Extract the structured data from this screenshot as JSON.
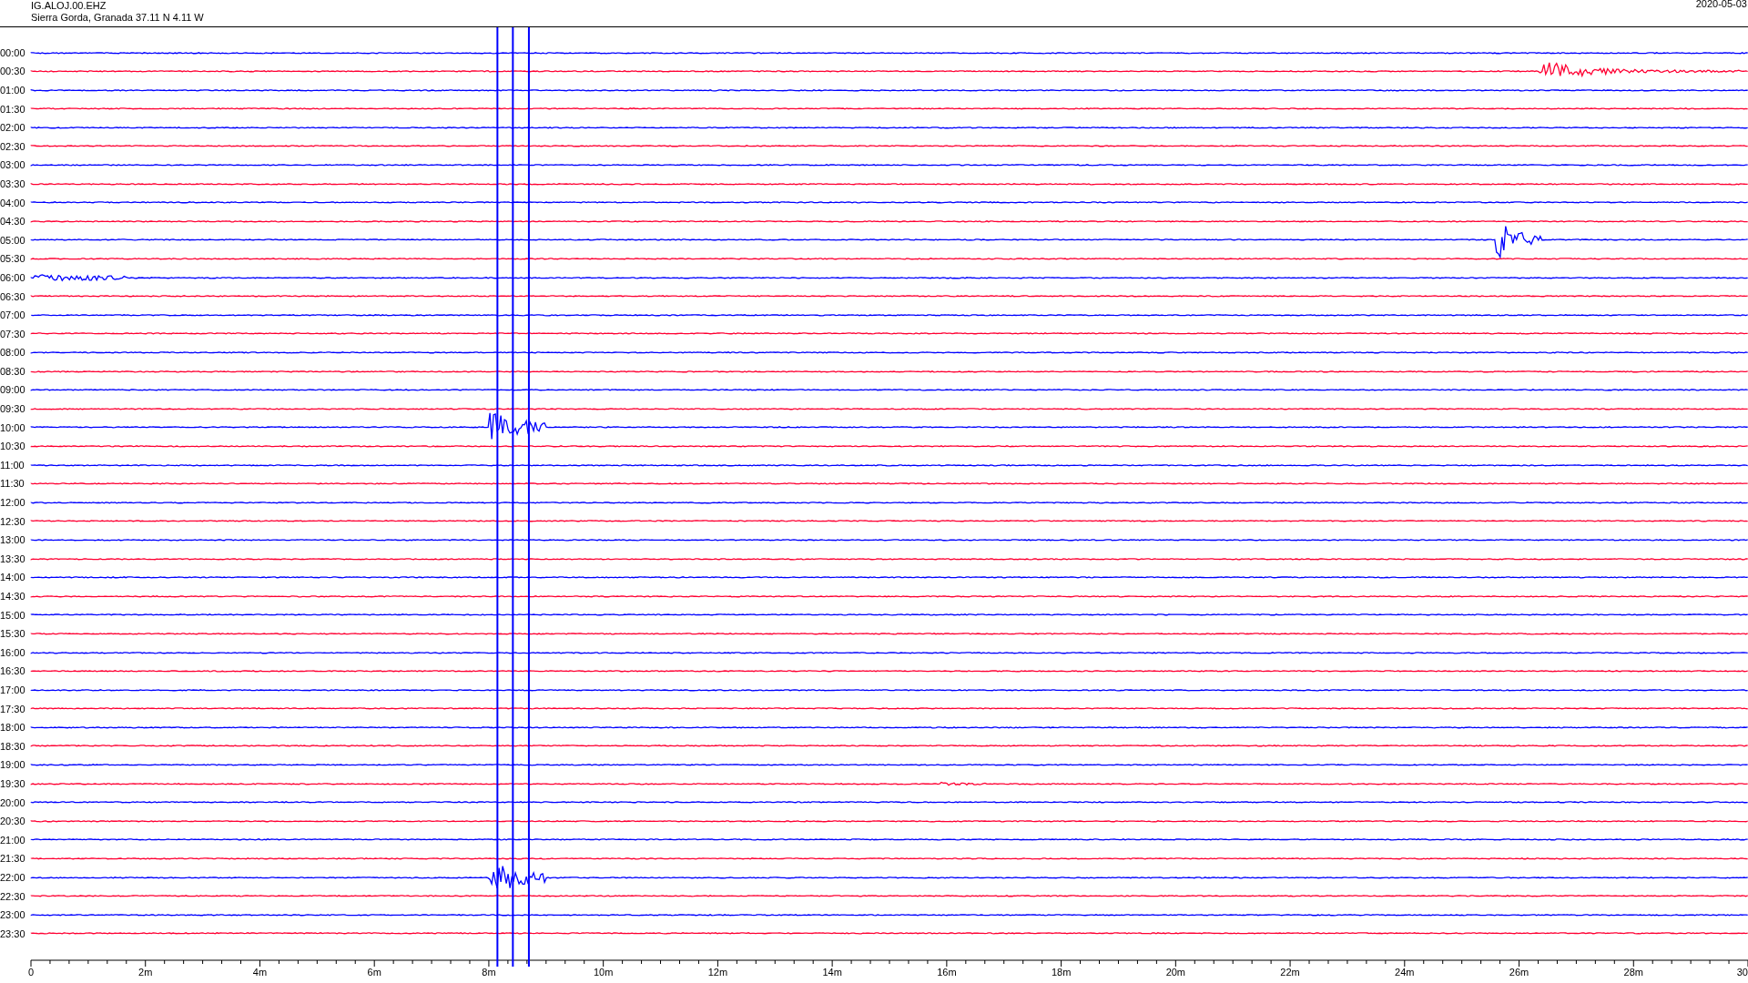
{
  "header": {
    "station": "IG.ALOJ.00.EHZ",
    "location": "Sierra Gorda, Granada  37.11 N 4.11 W",
    "date": "2020-05-03"
  },
  "rows": [
    {
      "time": "00:00",
      "color": "#0000ff"
    },
    {
      "time": "00:30",
      "color": "#ff0033"
    },
    {
      "time": "01:00",
      "color": "#0000ff"
    },
    {
      "time": "01:30",
      "color": "#ff0033"
    },
    {
      "time": "02:00",
      "color": "#0000ff"
    },
    {
      "time": "02:30",
      "color": "#ff0033"
    },
    {
      "time": "03:00",
      "color": "#0000ff"
    },
    {
      "time": "03:30",
      "color": "#ff0033"
    },
    {
      "time": "04:00",
      "color": "#0000ff"
    },
    {
      "time": "04:30",
      "color": "#ff0033"
    },
    {
      "time": "05:00",
      "color": "#0000ff"
    },
    {
      "time": "05:30",
      "color": "#ff0033"
    },
    {
      "time": "06:00",
      "color": "#0000ff"
    },
    {
      "time": "06:30",
      "color": "#ff0033"
    },
    {
      "time": "07:00",
      "color": "#0000ff"
    },
    {
      "time": "07:30",
      "color": "#ff0033"
    },
    {
      "time": "08:00",
      "color": "#0000ff"
    },
    {
      "time": "08:30",
      "color": "#ff0033"
    },
    {
      "time": "09:00",
      "color": "#0000ff"
    },
    {
      "time": "09:30",
      "color": "#ff0033"
    },
    {
      "time": "10:00",
      "color": "#0000ff"
    },
    {
      "time": "10:30",
      "color": "#ff0033"
    },
    {
      "time": "11:00",
      "color": "#0000ff"
    },
    {
      "time": "11:30",
      "color": "#ff0033"
    },
    {
      "time": "12:00",
      "color": "#0000ff"
    },
    {
      "time": "12:30",
      "color": "#ff0033"
    },
    {
      "time": "13:00",
      "color": "#0000ff"
    },
    {
      "time": "13:30",
      "color": "#ff0033"
    },
    {
      "time": "14:00",
      "color": "#0000ff"
    },
    {
      "time": "14:30",
      "color": "#ff0033"
    },
    {
      "time": "15:00",
      "color": "#0000ff"
    },
    {
      "time": "15:30",
      "color": "#ff0033"
    },
    {
      "time": "16:00",
      "color": "#0000ff"
    },
    {
      "time": "16:30",
      "color": "#ff0033"
    },
    {
      "time": "17:00",
      "color": "#0000ff"
    },
    {
      "time": "17:30",
      "color": "#ff0033"
    },
    {
      "time": "18:00",
      "color": "#0000ff"
    },
    {
      "time": "18:30",
      "color": "#ff0033"
    },
    {
      "time": "19:00",
      "color": "#0000ff"
    },
    {
      "time": "19:30",
      "color": "#ff0033"
    },
    {
      "time": "20:00",
      "color": "#0000ff"
    },
    {
      "time": "20:30",
      "color": "#ff0033"
    },
    {
      "time": "21:00",
      "color": "#0000ff"
    },
    {
      "time": "21:30",
      "color": "#ff0033"
    },
    {
      "time": "22:00",
      "color": "#0000ff"
    },
    {
      "time": "22:30",
      "color": "#ff0033"
    },
    {
      "time": "23:00",
      "color": "#0000ff"
    },
    {
      "time": "23:30",
      "color": "#ff0033"
    }
  ],
  "x_axis": {
    "labels": [
      "0",
      "2m",
      "4m",
      "6m",
      "8m",
      "10m",
      "12m",
      "14m",
      "16m",
      "18m",
      "20m",
      "22m",
      "24m",
      "26m",
      "28m",
      "30"
    ]
  }
}
